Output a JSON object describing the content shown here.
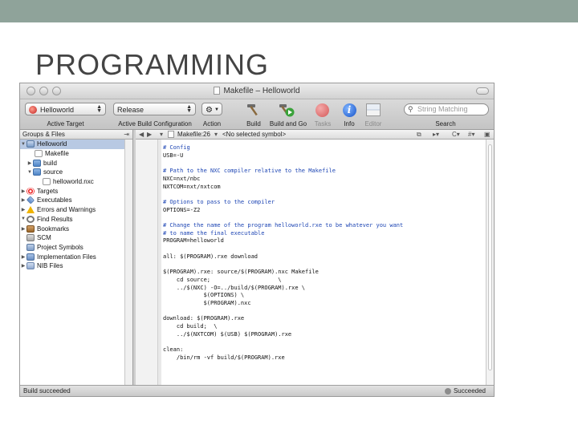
{
  "slide": {
    "title": "PROGRAMMING"
  },
  "window": {
    "title": "Makefile – Helloworld"
  },
  "toolbar": {
    "active_target_value": "Helloworld",
    "active_target_label": "Active Target",
    "build_config_value": "Release",
    "build_config_label": "Active Build Configuration",
    "action_label": "Action",
    "build_label": "Build",
    "build_and_go_label": "Build and Go",
    "tasks_label": "Tasks",
    "info_label": "Info",
    "editor_label": "Editor",
    "search_placeholder": "String Matching",
    "search_label": "Search"
  },
  "sidebar": {
    "header": "Groups & Files",
    "items": [
      {
        "label": "Helloworld"
      },
      {
        "label": "Makefile"
      },
      {
        "label": "build"
      },
      {
        "label": "source"
      },
      {
        "label": "helloworld.nxc"
      },
      {
        "label": "Targets"
      },
      {
        "label": "Executables"
      },
      {
        "label": "Errors and Warnings"
      },
      {
        "label": "Find Results"
      },
      {
        "label": "Bookmarks"
      },
      {
        "label": "SCM"
      },
      {
        "label": "Project Symbols"
      },
      {
        "label": "Implementation Files"
      },
      {
        "label": "NIB Files"
      }
    ]
  },
  "editor": {
    "file_position": "Makefile:26",
    "symbol": "<No selected symbol>",
    "code_lines": [
      "# Config",
      "USB=-U",
      "",
      "# Path to the NXC compiler relative to the Makefile",
      "NXC=nxt/nbc",
      "NXTCOM=nxt/nxtcom",
      "",
      "# Options to pass to the compiler",
      "OPTIONS=-Z2",
      "",
      "# Change the name of the program helloworld.rxe to be whatever you want",
      "# to name the final executable",
      "PROGRAM=helloworld",
      "",
      "all: $(PROGRAM).rxe download",
      "",
      "$(PROGRAM).rxe: source/$(PROGRAM).nxc Makefile",
      "    cd source;                    \\",
      "    ../$(NXC) -O=../build/$(PROGRAM).rxe \\",
      "            $(OPTIONS) \\",
      "            $(PROGRAM).nxc",
      "",
      "download: $(PROGRAM).rxe",
      "    cd build;  \\",
      "    ../$(NXTCOM) $(USB) $(PROGRAM).rxe",
      "",
      "clean:",
      "    /bin/rm -vf build/$(PROGRAM).rxe"
    ]
  },
  "status": {
    "left": "Build succeeded",
    "right": "Succeeded"
  },
  "colors": {
    "slide_topbar": "#8fa39a",
    "comment": "#1e46b4",
    "selection": "#b8c9e3"
  }
}
